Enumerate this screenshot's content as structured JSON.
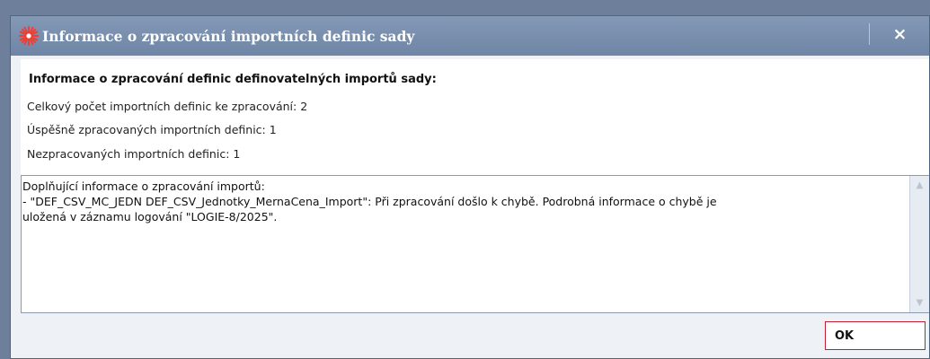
{
  "window": {
    "title": "Informace o zpracování importních definic sady",
    "close_label": "×",
    "icon": "star-burst-icon",
    "icon_color": "#e8423a"
  },
  "summary": {
    "heading": "Informace o zpracování definic definovatelných importů sady:",
    "total": "Celkový počet importních definic ke zpracování: 2",
    "succeeded": "Úspěšně zpracovaných importních definic: 1",
    "failed": "Nezpracovaných importních definic: 1"
  },
  "details": {
    "text": "Doplňující informace o zpracování importů:\n- \"DEF_CSV_MC_JEDN DEF_CSV_Jednotky_MernaCena_Import\": Při zpracování došlo k chybě. Podrobná informace o chybě je\nuložená v záznamu logování \"LOGIE-8/2025\"."
  },
  "buttons": {
    "ok_label": "OK"
  },
  "colors": {
    "titlebar": "#7a8faf",
    "ok_border": "#c11d2b"
  }
}
